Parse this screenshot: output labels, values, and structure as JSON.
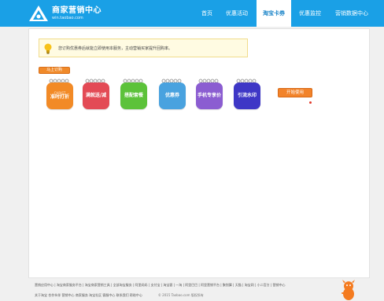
{
  "header": {
    "logo_title": "商家营销中心",
    "logo_sub": "win.taobao.com",
    "nav": [
      {
        "label": "首页"
      },
      {
        "label": "优惠活动"
      },
      {
        "label": "淘宝卡券"
      },
      {
        "label": "优惠监控"
      },
      {
        "label": "营销数据中心"
      }
    ],
    "active_index": 2
  },
  "tip": {
    "text": "您订购优惠券后就能立即使用本服务，主动营销买家提升回购率。"
  },
  "small_button": "马上订购",
  "apps": [
    {
      "label": "准时打折",
      "sub": "CHRIST",
      "color": "#f28a26"
    },
    {
      "label": "满就送/减",
      "sub": "",
      "color": "#e34a55"
    },
    {
      "label": "搭配套餐",
      "sub": "",
      "color": "#5cc23a"
    },
    {
      "label": "优惠券",
      "sub": "",
      "color": "#49a2df"
    },
    {
      "label": "手机专享价",
      "sub": "",
      "color": "#8b5dd1"
    },
    {
      "label": "引流水印",
      "sub": "",
      "color": "#3e37c6"
    }
  ],
  "start_button": "开始使用",
  "footer": {
    "links": "营销应用中心 | 淘宝商家服务平台 | 淘宝商家营销工具 | 全部淘宝服务 | 阿里妈妈 | 支付宝 | 淘宝客 | 一淘 | 阿里巴巴 | 阿里营销平台 | 聚划算 | 天猫 | 淘宝网 | 小二官方 | 营销中心",
    "bottom_links": "关于淘宝  合作伙伴  营销中心  商家服务  淘宝社区  客服中心  联系我们  帮助中心",
    "copyright": "© 2015 Taobao.com 版权所有"
  },
  "colors": {
    "header": "#1aa0e6",
    "accent": "#f2832a"
  }
}
